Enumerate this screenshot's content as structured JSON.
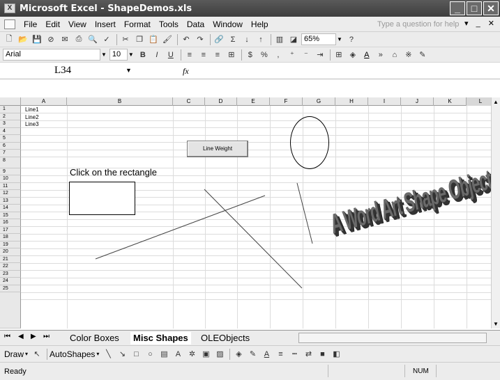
{
  "window": {
    "title": "Microsoft Excel - ShapeDemos.xls"
  },
  "menu": {
    "items": [
      "File",
      "Edit",
      "View",
      "Insert",
      "Format",
      "Tools",
      "Data",
      "Window",
      "Help"
    ],
    "help_placeholder": "Type a question for help"
  },
  "toolbar": {
    "zoom": "65%",
    "font_name": "Arial",
    "font_size": "10"
  },
  "formula": {
    "name_box": "L34",
    "fx": "fx"
  },
  "columns": [
    "A",
    "B",
    "C",
    "D",
    "E",
    "F",
    "G",
    "H",
    "I",
    "J",
    "K",
    "L"
  ],
  "rows": [
    "1",
    "2",
    "3",
    "4",
    "5",
    "6",
    "7",
    "8",
    "9",
    "10",
    "11",
    "12",
    "13",
    "14",
    "15",
    "16",
    "17",
    "18",
    "19",
    "20",
    "21",
    "22",
    "23",
    "24",
    "25"
  ],
  "cells": {
    "a1": "Line1",
    "a2": "Line2",
    "a3": "Line3",
    "b8": "Click on the rectangle"
  },
  "shapes": {
    "button_label": "Line Weight",
    "wordart_text": "A Word Art Shape Object"
  },
  "sheet_tabs": [
    "Color Boxes",
    "Misc Shapes",
    "OLEObjects"
  ],
  "active_tab": "Misc Shapes",
  "drawbar": {
    "draw": "Draw",
    "autoshapes": "AutoShapes"
  },
  "status": {
    "ready": "Ready",
    "num": "NUM"
  }
}
